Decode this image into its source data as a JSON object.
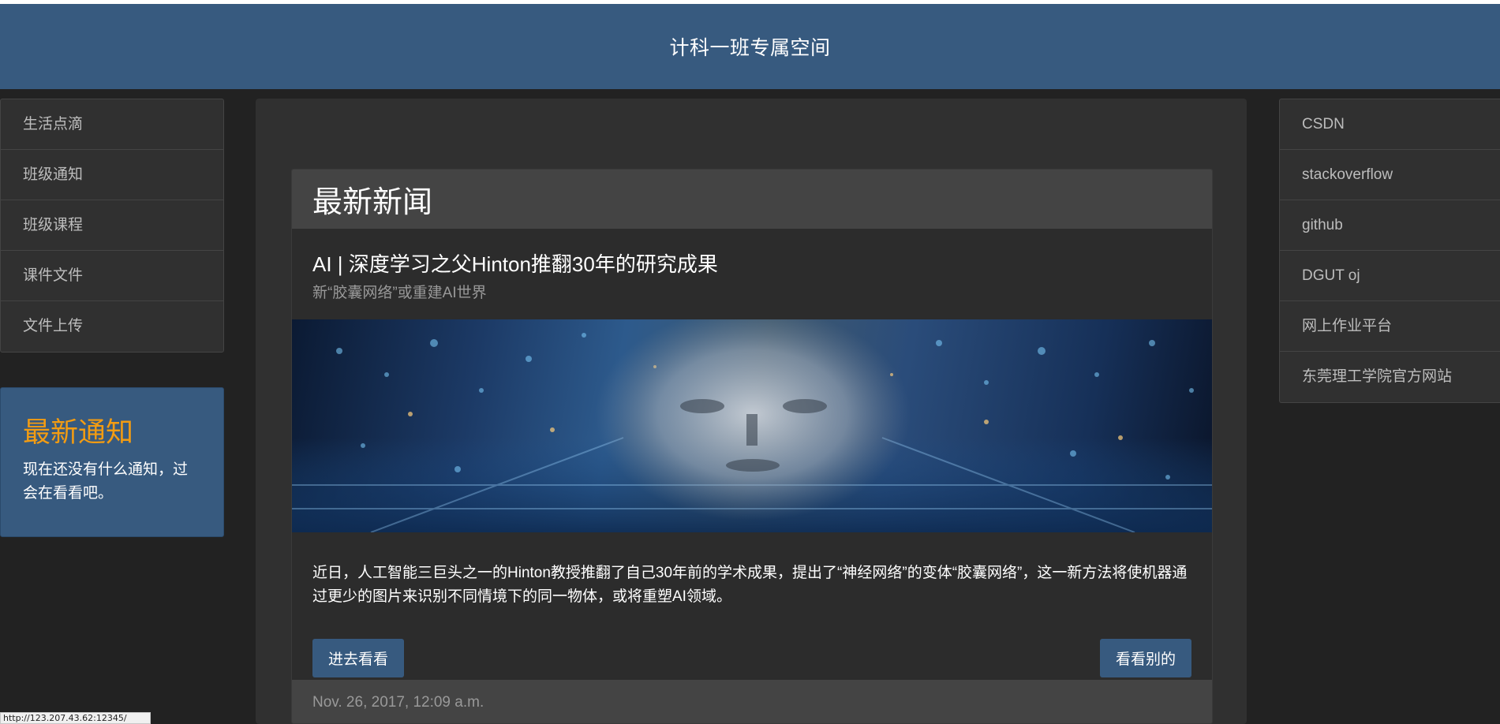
{
  "navbar": {
    "title": "计科一班专属空间"
  },
  "left_menu": {
    "items": [
      "生活点滴",
      "班级通知",
      "班级课程",
      "课件文件",
      "文件上传"
    ]
  },
  "notice": {
    "title": "最新通知",
    "text": "现在还没有什么通知，过会在看看吧。"
  },
  "news": {
    "header": "最新新闻",
    "title": "AI | 深度学习之父Hinton推翻30年的研究成果",
    "subtitle": "新“胶囊网络”或重建AI世界",
    "image_alt": "ai-face-cityscape-image",
    "body": "近日，人工智能三巨头之一的Hinton教授推翻了自己30年前的学术成果，提出了“神经网络”的变体“胶囊网络”，这一新方法将使机器通过更少的图片来识别不同情境下的同一物体，或将重塑AI领域。",
    "enter_button": "进去看看",
    "other_button": "看看别的",
    "date": "Nov. 26, 2017, 12:09 a.m."
  },
  "right_menu": {
    "items": [
      "CSDN",
      "stackoverflow",
      "github",
      "DGUT oj",
      "网上作业平台",
      "东莞理工学院官方网站"
    ]
  },
  "status_bar": {
    "url": "http://123.207.43.62:12345/"
  },
  "colors": {
    "navbar": "#375a7f",
    "background": "#222222",
    "panel": "#303030",
    "accent_orange": "#f39c12"
  }
}
